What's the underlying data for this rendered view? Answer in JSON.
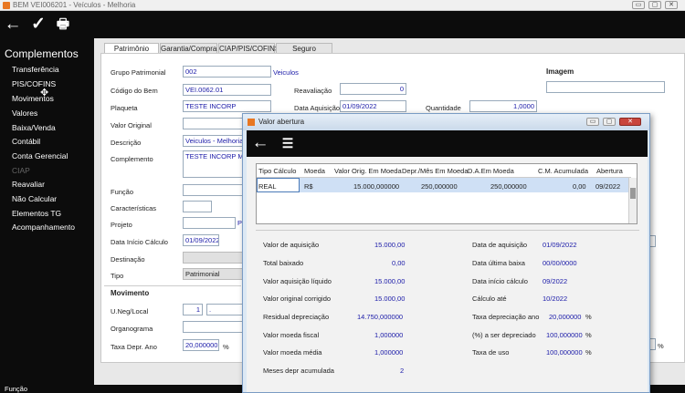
{
  "window": {
    "title": "BEM VEI006201 - Veículos - Melhoria",
    "btn_min": "▭",
    "btn_max": "▢",
    "btn_close": "✕"
  },
  "toolbar": {
    "back_icon": "←",
    "confirm_icon": "✓",
    "print_icon": "🖶"
  },
  "sidebar": {
    "title": "Complementos",
    "items": [
      "Transferência",
      "PIS/COFINS",
      "Movimentos",
      "Valores",
      "Baixa/Venda",
      "Contábil",
      "Conta Gerencial",
      "CIAP",
      "Reavaliar",
      "Não Calcular",
      "Elementos TG",
      "Acompanhamento"
    ],
    "disabled": "CIAP"
  },
  "tabs": [
    "Patrimônio",
    "Garantia/Compra",
    "CIAP/PIS/COFINS",
    "Seguro"
  ],
  "form": {
    "grupo_label": "Grupo Patrimonial",
    "grupo_value": "002",
    "grupo_desc": "Veiculos",
    "codigo_label": "Código do Bem",
    "codigo_value": "VEI.0062.01",
    "placa_label": "Plaqueta",
    "placa_value": "TESTE INCORP",
    "valor_orig_label": "Valor Original",
    "descricao_label": "Descrição",
    "descricao_value": "Veiculos - Melhoria",
    "complemento_label": "Complemento",
    "complemento_value": "TESTE INCORP Melho",
    "funcao_label": "Função",
    "caracteristicas_label": "Características",
    "projeto_label": "Projeto",
    "data_inicio_label": "Data Início Cálculo",
    "data_inicio_value": "01/09/2022",
    "destinacao_label": "Destinação",
    "tipo_label": "Tipo",
    "tipo_value": "Patrimonial",
    "reavaliacao_label": "Reavaliação",
    "reavaliacao_value": "0",
    "data_aquisicao_label": "Data Aquisição",
    "data_aquisicao_value": "01/09/2022",
    "quantidade_label": "Quantidade",
    "quantidade_value": "1,0000",
    "imagem_label": "Imagem",
    "movimento_label": "Movimento",
    "uneg_label": "U.Neg/Local",
    "uneg_value": "1",
    "uneg_value2": ".",
    "organograma_label": "Organograma",
    "taxa_label": "Taxa Depr. Ano",
    "taxa_value": "20,000000",
    "taxa_unit": "%",
    "side_pct": "%",
    "bottom_funcao": "Função"
  },
  "dialog": {
    "title": "Valor abertura",
    "back_icon": "←",
    "list_icon": "☰",
    "columns": [
      "Tipo Cálculo",
      "Moeda",
      "Valor Orig. Em Moeda",
      "Depr./Mês Em Moeda",
      "D.A.Em Moeda",
      "C.M. Acumulada",
      "Abertura"
    ],
    "row": [
      "REAL",
      "R$",
      "15.000,000000",
      "250,000000",
      "250,000000",
      "0,00",
      "09/2022"
    ],
    "left": [
      {
        "label": "Valor de aquisição",
        "value": "15.000,00"
      },
      {
        "label": "Total baixado",
        "value": "0,00"
      },
      {
        "label": "Valor aquisição líquido",
        "value": "15.000,00"
      },
      {
        "label": "Valor original corrigido",
        "value": "15.000,00"
      },
      {
        "label": "Residual depreciação",
        "value": "14.750,000000"
      },
      {
        "label": "Valor moeda fiscal",
        "value": "1,000000"
      },
      {
        "label": "Valor moeda média",
        "value": "1,000000"
      },
      {
        "label": "Meses depr acumulada",
        "value": "2"
      }
    ],
    "right": [
      {
        "label": "Data de aquisição",
        "value": "01/09/2022"
      },
      {
        "label": "Data última baixa",
        "value": "00/00/0000"
      },
      {
        "label": "Data início cálculo",
        "value": "09/2022"
      },
      {
        "label": "Cálculo até",
        "value": "10/2022"
      },
      {
        "label": "Taxa depreciação ano",
        "value": "20,000000",
        "unit": "%"
      },
      {
        "label": "(%) a ser depreciado",
        "value": "100,000000",
        "unit": "%"
      },
      {
        "label": "Taxa de uso",
        "value": "100,000000",
        "unit": "%"
      }
    ]
  }
}
